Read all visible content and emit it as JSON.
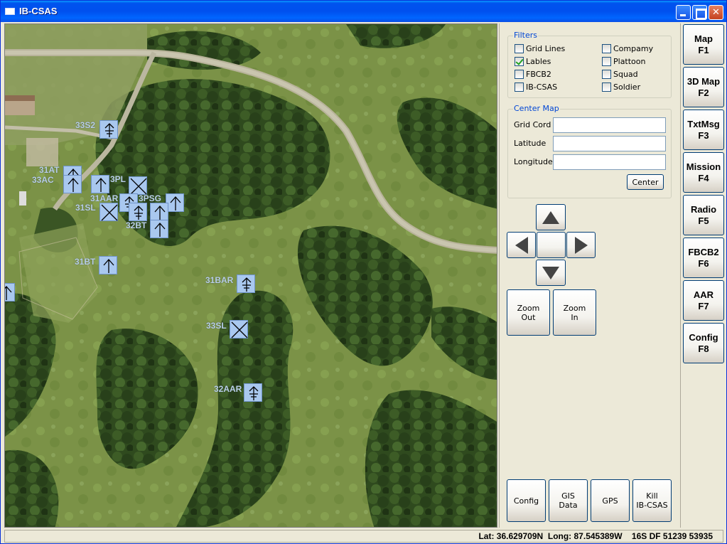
{
  "window": {
    "title": "IB-CSAS",
    "minimize": "_",
    "maximize": "□",
    "close": "✕"
  },
  "map": {
    "units": [
      {
        "label": "33S2",
        "icon": "antenna-icon"
      },
      {
        "label": "31AT",
        "icon": "arrow-icon"
      },
      {
        "label": "33AC",
        "icon": "arrow-icon"
      },
      {
        "label": "3PL",
        "icon": "x-icon"
      },
      {
        "label": "31AAR",
        "icon": "antenna-icon"
      },
      {
        "label": "3PSG",
        "icon": "arrow-icon"
      },
      {
        "label": "31SL",
        "icon": "x-icon"
      },
      {
        "label": "32BT",
        "icon": "arrow-icon"
      },
      {
        "label": "31BT",
        "icon": "arrow-icon"
      },
      {
        "label": "31BAR",
        "icon": "antenna-icon"
      },
      {
        "label": "33SL",
        "icon": "x-icon"
      },
      {
        "label": "32AAR",
        "icon": "antenna-icon"
      }
    ]
  },
  "filters": {
    "title": "Filters",
    "items": [
      {
        "label": "Grid Lines",
        "checked": false
      },
      {
        "label": "Lables",
        "checked": true
      },
      {
        "label": "FBCB2",
        "checked": false
      },
      {
        "label": "IB-CSAS",
        "checked": false
      },
      {
        "label": "Compamy",
        "checked": false
      },
      {
        "label": "Plattoon",
        "checked": false
      },
      {
        "label": "Squad",
        "checked": false
      },
      {
        "label": "Soldier",
        "checked": false
      }
    ]
  },
  "center_map": {
    "title": "Center Map",
    "grid_label": "Grid Cord",
    "grid_value": "",
    "lat_label": "Latitude",
    "lat_value": "",
    "long_label": "Longitude",
    "long_value": "",
    "center_button": "Center"
  },
  "zoom": {
    "out": "Zoom\nOut",
    "in": "Zoom\nIn"
  },
  "bottom_buttons": {
    "config": "Config",
    "gis": "GIS\nData",
    "gps": "GPS",
    "kill": "Kill\nIB-CSAS"
  },
  "fkeys": [
    {
      "name": "Map",
      "key": "F1"
    },
    {
      "name": "3D Map",
      "key": "F2"
    },
    {
      "name": "TxtMsg",
      "key": "F3"
    },
    {
      "name": "Mission",
      "key": "F4"
    },
    {
      "name": "Radio",
      "key": "F5"
    },
    {
      "name": "FBCB2",
      "key": "F6"
    },
    {
      "name": "AAR",
      "key": "F7"
    },
    {
      "name": "Config",
      "key": "F8"
    }
  ],
  "status": {
    "lat": "Lat: 36.629709N",
    "long": "Long: 87.545389W",
    "grid": "16S DF 51239 53935"
  },
  "colors": {
    "title_bar": "#0054e3",
    "unit_fill": "#a9c8ef",
    "panel_bg": "#ece9d8",
    "legend_text": "#0046d5"
  }
}
